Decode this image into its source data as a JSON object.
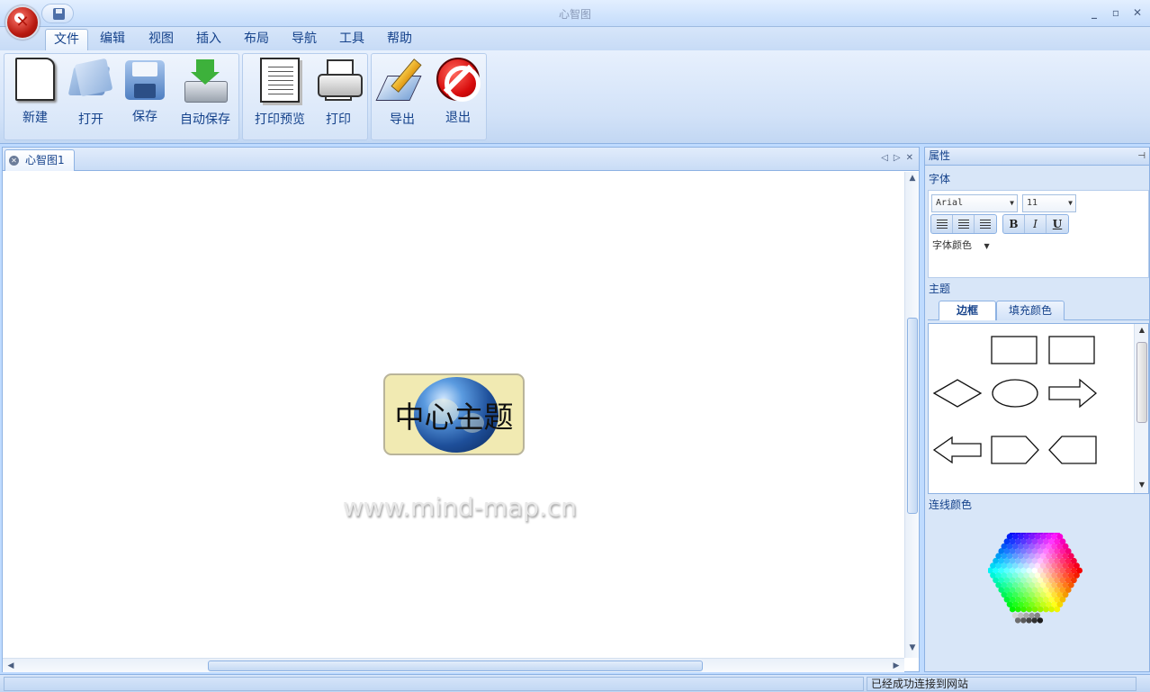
{
  "app": {
    "title": "心智图"
  },
  "menu": [
    "文件",
    "编辑",
    "视图",
    "插入",
    "布局",
    "导航",
    "工具",
    "帮助"
  ],
  "ribbon": {
    "new": "新建",
    "open": "打开",
    "save": "保存",
    "autosave": "自动保存",
    "print_preview": "打印预览",
    "print": "打印",
    "export": "导出",
    "exit": "退出"
  },
  "document": {
    "tab_label": "心智图1",
    "central_topic": "中心主题",
    "watermark": "www.mind-map.cn"
  },
  "properties": {
    "header": "属性",
    "font_section": "字体",
    "font_name": "Arial",
    "font_size": "11",
    "bold_label": "B",
    "italic_label": "I",
    "underline_label": "U",
    "font_color_label": "字体颜色",
    "theme_section": "主题",
    "theme_tabs": [
      "边框",
      "填充颜色"
    ],
    "line_color_label": "连线颜色"
  },
  "status": {
    "message": "已经成功连接到网站"
  },
  "colors": {
    "accent": "#15428b",
    "central_fill": "#f1eab2",
    "panel_bg": "#d8e6f8"
  }
}
